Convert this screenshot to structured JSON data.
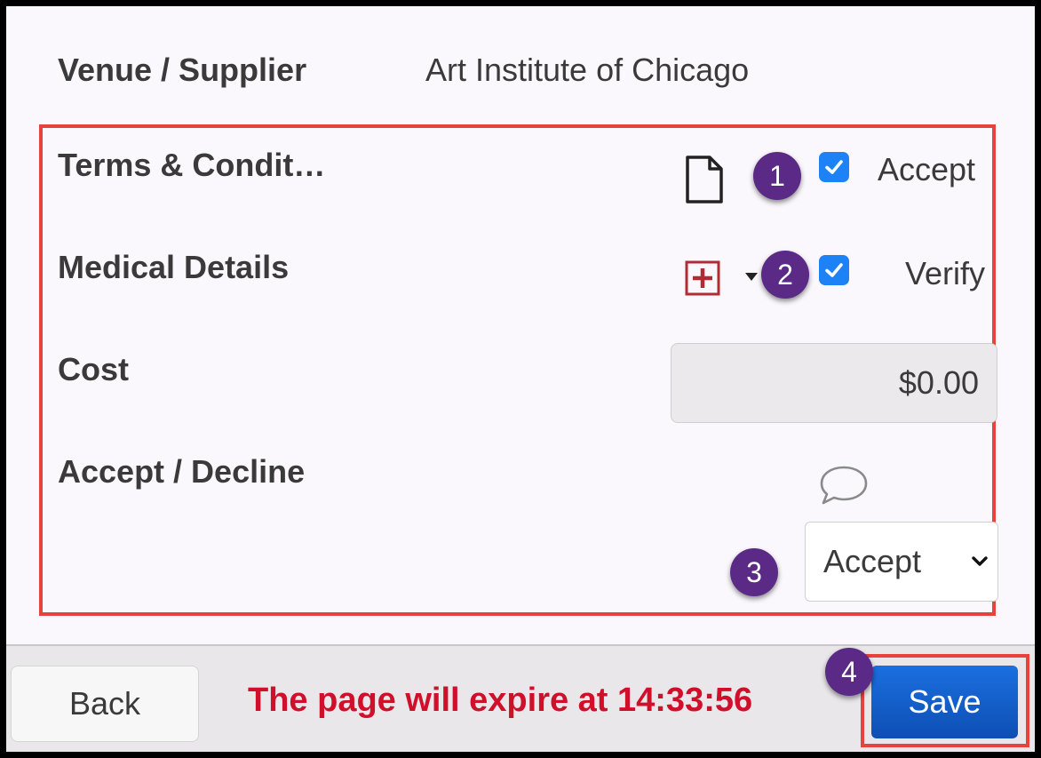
{
  "venue": {
    "label": "Venue / Supplier",
    "value": "Art Institute of Chicago"
  },
  "fields": {
    "terms": {
      "label": "Terms & Condit…",
      "checkbox_checked": true,
      "checkbox_label": "Accept",
      "icon": "document-icon"
    },
    "medical": {
      "label": "Medical Details",
      "checkbox_checked": true,
      "checkbox_label": "Verify",
      "icon": "medical-plus-icon"
    },
    "cost": {
      "label": "Cost",
      "value": "$0.00"
    },
    "accept_decline": {
      "label": "Accept / Decline",
      "selected": "Accept",
      "icon": "comment-icon"
    }
  },
  "annotations": {
    "one": "1",
    "two": "2",
    "three": "3",
    "four": "4"
  },
  "footer": {
    "back_label": "Back",
    "expire_text": "The page will expire at 14:33:56",
    "save_label": "Save"
  },
  "colors": {
    "highlight": "#e8423c",
    "badge": "#5a2a86",
    "checkbox": "#1d82f5",
    "expire_text": "#d0102a",
    "save_button": "#0d4fb4"
  }
}
